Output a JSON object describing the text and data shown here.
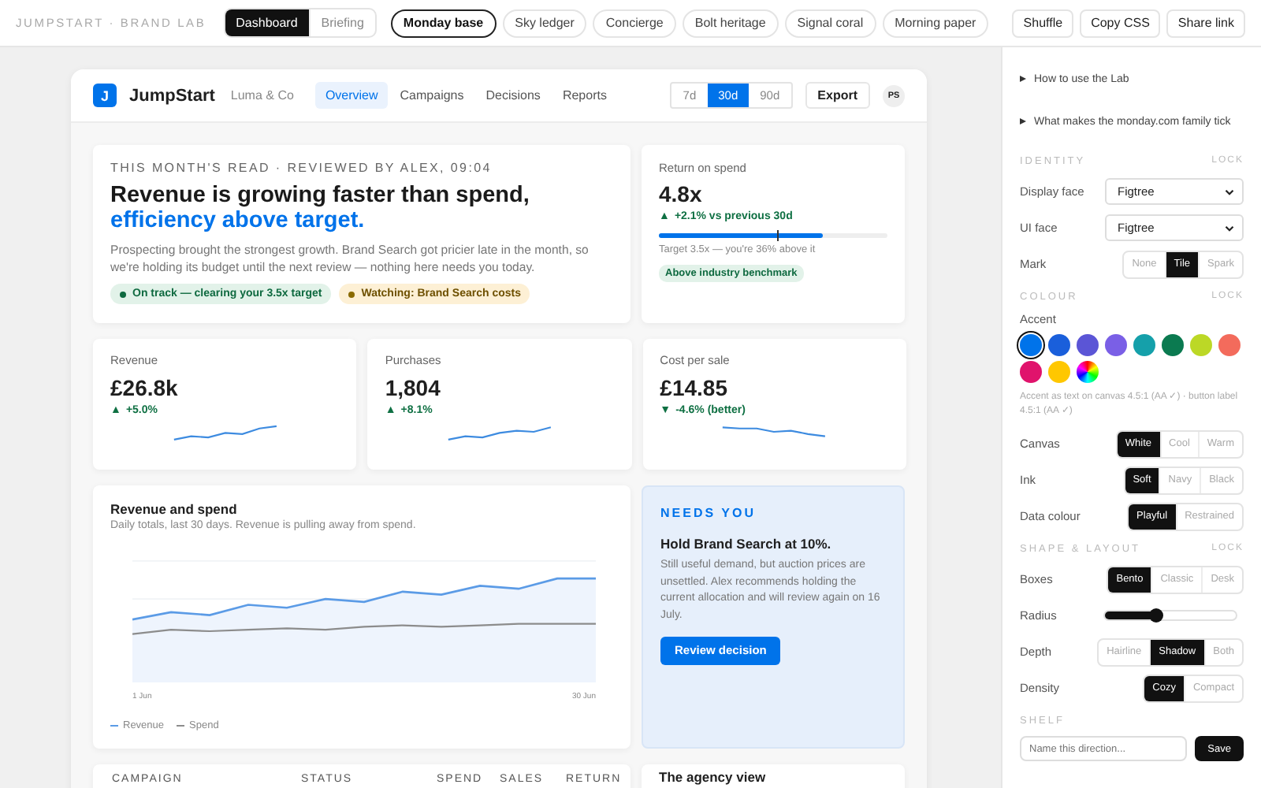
{
  "topbar": {
    "brand": "JUMPSTART · BRAND LAB",
    "views": [
      {
        "label": "Dashboard",
        "selected": true
      },
      {
        "label": "Briefing",
        "selected": false
      }
    ],
    "presets": [
      {
        "label": "Monday base",
        "selected": true
      },
      {
        "label": "Sky ledger",
        "selected": false
      },
      {
        "label": "Concierge",
        "selected": false
      },
      {
        "label": "Bolt heritage",
        "selected": false
      },
      {
        "label": "Signal coral",
        "selected": false
      },
      {
        "label": "Morning paper",
        "selected": false
      }
    ],
    "actions": [
      "Shuffle",
      "Copy CSS",
      "Share link"
    ]
  },
  "app": {
    "logo": "J",
    "name": "JumpStart",
    "client": "Luma & Co",
    "nav": [
      {
        "label": "Overview",
        "selected": true
      },
      {
        "label": "Campaigns",
        "selected": false
      },
      {
        "label": "Decisions",
        "selected": false
      },
      {
        "label": "Reports",
        "selected": false
      }
    ],
    "ranges": [
      {
        "label": "7d",
        "selected": false
      },
      {
        "label": "30d",
        "selected": true
      },
      {
        "label": "90d",
        "selected": false
      }
    ],
    "export": "Export",
    "avatar": "PS"
  },
  "summary": {
    "eyebrow": "THIS MONTH'S READ · REVIEWED BY ALEX, 09:04",
    "headline": "Revenue is growing faster than spend,",
    "headline_accent": "efficiency above target.",
    "body": "Prospecting brought the strongest growth. Brand Search got pricier late in the month, so we're holding its budget until the next review — nothing here needs you today.",
    "tags": [
      {
        "kind": "good",
        "label": "On track — clearing your 3.5x target"
      },
      {
        "kind": "watch",
        "label": "Watching: Brand Search costs"
      }
    ]
  },
  "ros": {
    "label": "Return on spend",
    "value": "4.8x",
    "arrow": "▲",
    "delta": "+2.1% vs previous 30d",
    "level": 0.72,
    "target_marker": {
      "level": 0.52
    },
    "note": "Target 3.5x — you're 36% above it",
    "badge": "Above industry benchmark"
  },
  "kpis": [
    {
      "label": "Revenue",
      "value": "£26.8k",
      "arrow": "▲",
      "delta": "+5.0%"
    },
    {
      "label": "Purchases",
      "value": "1,804",
      "arrow": "▲",
      "delta": "+8.1%"
    },
    {
      "label": "Cost per sale",
      "value": "£14.85",
      "arrow": "▼",
      "delta": "-4.6% (better)"
    }
  ],
  "trend": {
    "title": "Revenue and spend",
    "subtitle": "Daily totals, last 30 days. Revenue is pulling away from spend.",
    "x_labels": [
      "1 Jun",
      "30 Jun"
    ],
    "legend": [
      {
        "name": "Revenue",
        "color": "#5b9be6"
      },
      {
        "name": "Spend",
        "color": "#8c8c8c"
      }
    ]
  },
  "decision": {
    "eyebrow": "NEEDS YOU",
    "title": "Hold Brand Search at 10%.",
    "body": "Still useful demand, but auction prices are unsettled. Alex recommends holding the current allocation and will review again on 16 July.",
    "button": "Review decision"
  },
  "table": {
    "columns": [
      "CAMPAIGN",
      "STATUS",
      "SPEND",
      "SALES",
      "RETURN"
    ]
  },
  "agency": {
    "title": "The agency view"
  },
  "panel": {
    "disclosures": [
      {
        "label": "How to use the Lab",
        "expanded": false
      },
      {
        "label": "What makes the monday.com family tick",
        "expanded": false
      }
    ],
    "sections": [
      {
        "title": "IDENTITY",
        "lock": "LOCK",
        "rows": [
          {
            "kind": "select",
            "label": "Display face",
            "value": "Figtree"
          },
          {
            "kind": "select",
            "label": "UI face",
            "value": "Figtree"
          },
          {
            "kind": "segmented",
            "label": "Mark",
            "options": [
              {
                "label": "None",
                "selected": false
              },
              {
                "label": "Tile",
                "selected": true
              },
              {
                "label": "Spark",
                "selected": false
              }
            ]
          }
        ]
      },
      {
        "title": "COLOUR",
        "lock": "LOCK",
        "rows": [
          {
            "kind": "swatches",
            "label": "Accent",
            "swatches": [
              {
                "kind": "solid",
                "color": "#0073ea",
                "selected": true
              },
              {
                "kind": "solid",
                "color": "#1a5fdb",
                "selected": false
              },
              {
                "kind": "solid",
                "color": "#5b55d6",
                "selected": false
              },
              {
                "kind": "solid",
                "color": "#7a5fe6",
                "selected": false
              },
              {
                "kind": "solid",
                "color": "#15a0aa",
                "selected": false
              },
              {
                "kind": "solid",
                "color": "#0b7a50",
                "selected": false
              },
              {
                "kind": "solid",
                "color": "#bcd826",
                "selected": false
              },
              {
                "kind": "solid",
                "color": "#f36b5c",
                "selected": false
              },
              {
                "kind": "solid",
                "color": "#e0136c",
                "selected": false
              },
              {
                "kind": "solid",
                "color": "#ffc700",
                "selected": false
              },
              {
                "kind": "picker",
                "selected": false
              }
            ],
            "note": "Accent as text on canvas 4.5:1 (AA ✓) · button label 4.5:1 (AA ✓)"
          },
          {
            "kind": "segmented",
            "label": "Canvas",
            "options": [
              {
                "label": "White",
                "selected": true
              },
              {
                "label": "Cool",
                "selected": false
              },
              {
                "label": "Warm",
                "selected": false
              }
            ]
          },
          {
            "kind": "segmented",
            "label": "Ink",
            "options": [
              {
                "label": "Soft",
                "selected": true
              },
              {
                "label": "Navy",
                "selected": false
              },
              {
                "label": "Black",
                "selected": false
              }
            ]
          },
          {
            "kind": "segmented",
            "label": "Data colour",
            "options": [
              {
                "label": "Playful",
                "selected": true
              },
              {
                "label": "Restrained",
                "selected": false
              }
            ]
          }
        ]
      },
      {
        "title": "SHAPE & LAYOUT",
        "lock": "LOCK",
        "rows": [
          {
            "kind": "segmented",
            "label": "Boxes",
            "options": [
              {
                "label": "Bento",
                "selected": true
              },
              {
                "label": "Classic",
                "selected": false
              },
              {
                "label": "Desk",
                "selected": false
              }
            ]
          },
          {
            "kind": "slider",
            "label": "Radius",
            "level": 0.38
          },
          {
            "kind": "segmented",
            "label": "Depth",
            "options": [
              {
                "label": "Hairline",
                "selected": false
              },
              {
                "label": "Shadow",
                "selected": true
              },
              {
                "label": "Both",
                "selected": false
              }
            ]
          },
          {
            "kind": "segmented",
            "label": "Density",
            "options": [
              {
                "label": "Cozy",
                "selected": true
              },
              {
                "label": "Compact",
                "selected": false
              }
            ]
          }
        ]
      }
    ],
    "shelf": {
      "title": "SHELF",
      "placeholder": "Name this direction...",
      "button": "Save"
    }
  }
}
